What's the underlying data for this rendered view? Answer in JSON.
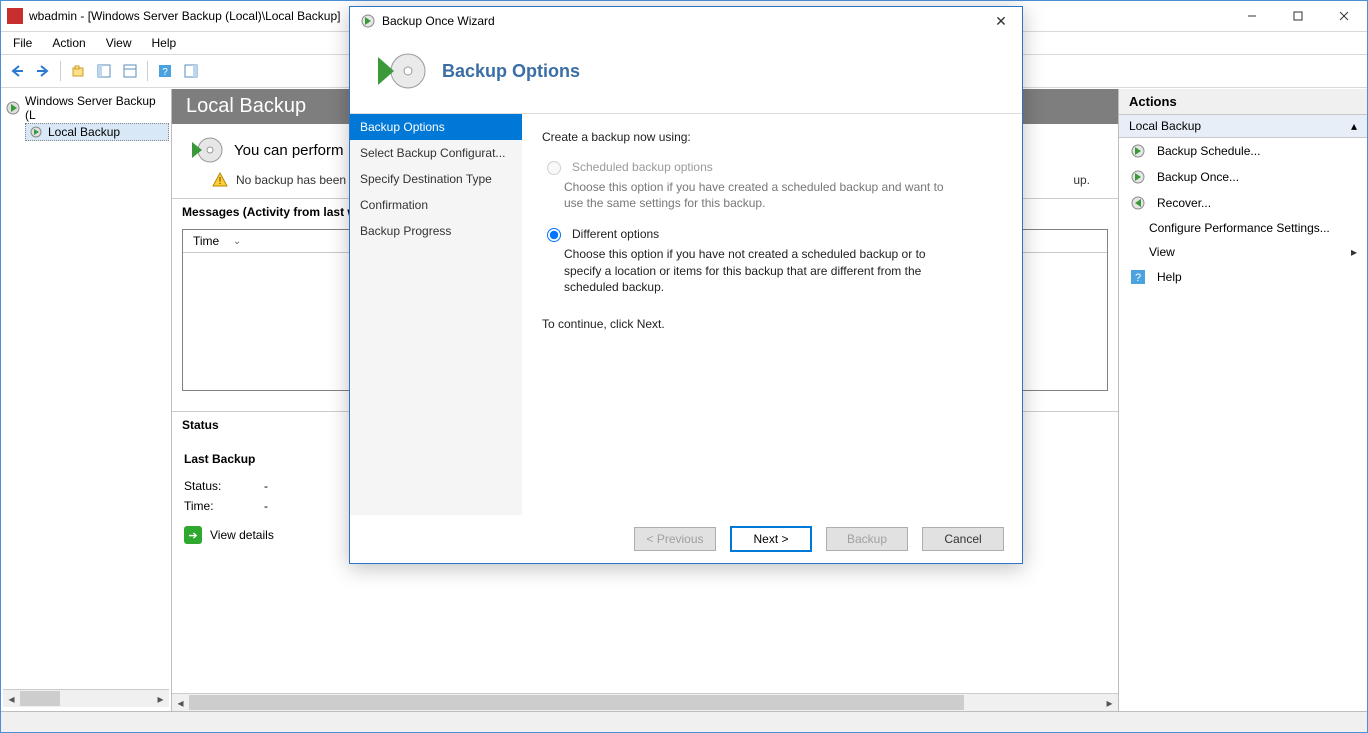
{
  "titlebar": {
    "title": "wbadmin - [Windows Server Backup (Local)\\Local Backup]"
  },
  "menubar": {
    "items": [
      "File",
      "Action",
      "View",
      "Help"
    ]
  },
  "tree": {
    "root": "Windows Server Backup (L",
    "child": "Local Backup"
  },
  "center": {
    "header": "Local Backup",
    "perform": "You can perform",
    "warn": "No backup has been co",
    "warn_tail": "up.",
    "messages_title": "Messages (Activity from last w",
    "col_time": "Time",
    "status_title": "Status",
    "last_backup": "Last Backup",
    "status_label": "Status:",
    "status_value": "-",
    "time_label": "Time:",
    "time_value": "-",
    "view_details": "View details"
  },
  "actions": {
    "title": "Actions",
    "group": "Local Backup",
    "items": [
      {
        "label": "Backup Schedule...",
        "icon": "schedule"
      },
      {
        "label": "Backup Once...",
        "icon": "once"
      },
      {
        "label": "Recover...",
        "icon": "recover"
      },
      {
        "label": "Configure Performance Settings...",
        "icon": ""
      }
    ],
    "view": "View",
    "help": "Help"
  },
  "dialog": {
    "title": "Backup Once Wizard",
    "heading": "Backup Options",
    "steps": [
      "Backup Options",
      "Select Backup Configurat...",
      "Specify Destination Type",
      "Confirmation",
      "Backup Progress"
    ],
    "intro": "Create a backup now using:",
    "opt1_label": "Scheduled backup options",
    "opt1_desc": "Choose this option if you have created a scheduled backup and want to use the same settings for this backup.",
    "opt2_label": "Different options",
    "opt2_desc": "Choose this option if you have not created a scheduled backup or to specify a location or items for this backup that are different from the scheduled backup.",
    "continue": "To continue, click Next.",
    "buttons": {
      "prev": "< Previous",
      "next": "Next >",
      "backup": "Backup",
      "cancel": "Cancel"
    }
  }
}
